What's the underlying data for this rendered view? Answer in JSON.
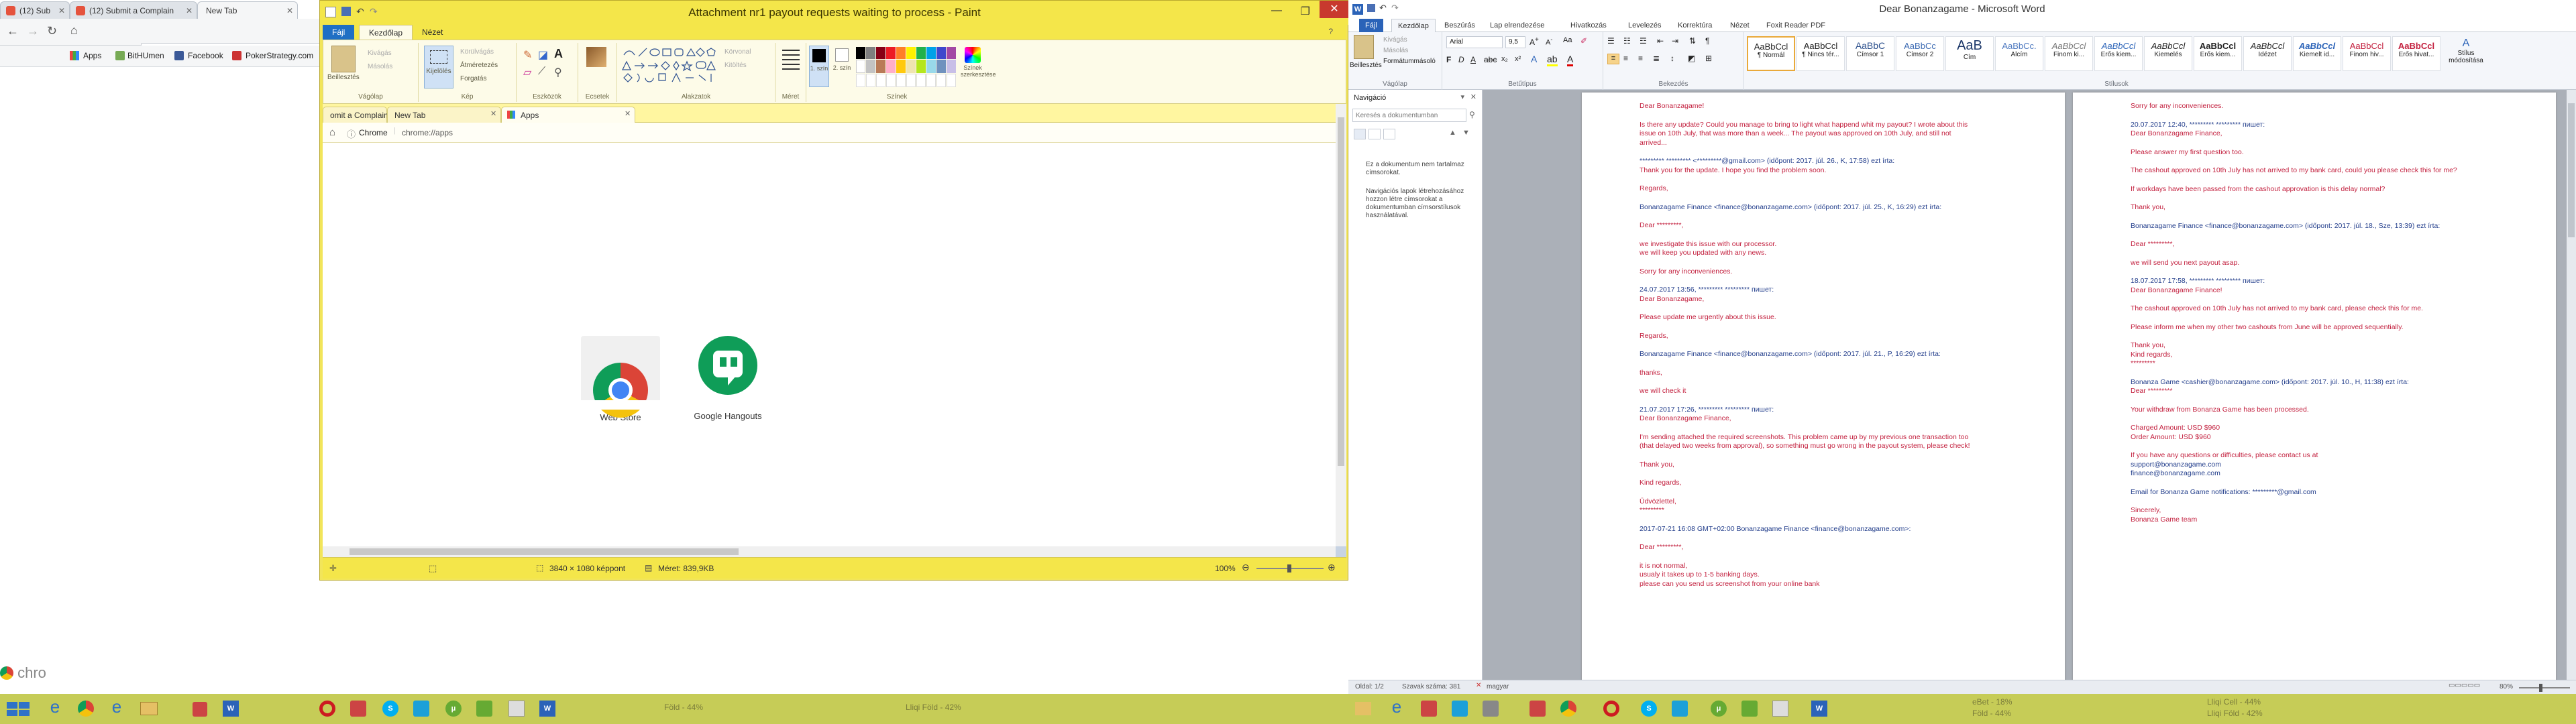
{
  "chrome": {
    "tabs": [
      "(12) Sub",
      "(12) Submit a Complain",
      "New Tab"
    ],
    "bookmarks": [
      "Apps",
      "BitHUmen",
      "Facebook",
      "PokerStrategy.com"
    ],
    "corner_text": "chro"
  },
  "paint": {
    "title": "Attachment nr1 payout requests waiting to process - Paint",
    "tabs": [
      "Fájl",
      "Kezdőlap",
      "Nézet"
    ],
    "groups": {
      "clipboard": {
        "paste": "Beillesztés",
        "cut": "Kivágás",
        "copy": "Másolás",
        "label": "Vágólap"
      },
      "image": {
        "select": "Kijelölés",
        "crop": "Körülvágás",
        "resize": "Átméretezés",
        "rotate": "Forgatás",
        "label": "Kép"
      },
      "tools": {
        "label": "Eszközök"
      },
      "brushes": {
        "label": "Ecsetek"
      },
      "shapes": {
        "outline": "Körvonal",
        "fill": "Kitöltés",
        "label": "Alakzatok"
      },
      "size": {
        "label": "Méret"
      },
      "colors": {
        "color1": "1. szín",
        "color2": "2. szín",
        "edit": "Színek szerkesztése",
        "label": "Színek"
      }
    },
    "status": {
      "dimensions": "3840 × 1080 képpont",
      "filesize": "Méret: 839,9KB",
      "zoom": "100%"
    },
    "screenshot": {
      "tabs": [
        "omit a Complain",
        "New Tab",
        "Apps"
      ],
      "address_site": "Chrome",
      "address_url": "chrome://apps",
      "apps": [
        "Web Store",
        "Google Hangouts"
      ]
    }
  },
  "word": {
    "title": "Dear Bonanzagame - Microsoft Word",
    "tabs": [
      "Fájl",
      "Kezdőlap",
      "Beszúrás",
      "Lap elrendezése",
      "Hivatkozás",
      "Levelezés",
      "Korrektúra",
      "Nézet",
      "Foxit Reader PDF"
    ],
    "ribbon": {
      "paste": "Beillesztés",
      "cut": "Kivágás",
      "copy": "Másolás",
      "format_painter": "Formátummásoló",
      "clipboard_label": "Vágólap",
      "font_label": "Betűtípus",
      "paragraph_label": "Bekezdés",
      "styles_label": "Stílusok",
      "font_name": "Arial",
      "font_size": "9,5",
      "styles": [
        "¶ Normál",
        "¶ Nincs tér...",
        "Címsor 1",
        "Címsor 2",
        "Cím",
        "Alcím",
        "Finom ki...",
        "Erős kiem...",
        "Kiemelés",
        "Erős kiem...",
        "Idézet",
        "Kiemelt id...",
        "Finom hiv...",
        "Erős hivat..."
      ],
      "change_styles": "Stílus módosítása"
    },
    "nav": {
      "title": "Navigáció",
      "search_placeholder": "Keresés a dokumentumban",
      "text1": "Ez a dokumentum nem tartalmaz címsorokat.",
      "text2": "Navigációs lapok létrehozásához hozzon létre címsorokat a dokumentumban címsorstílusok használatával."
    },
    "page1": [
      "Dear Bonanzagame!",
      "Is there any update? Could you manage to bring to light what happend whit my payout? I wrote about this",
      "issue on 10th July, that was more than a week... The payout was approved on 10th July, and still not",
      "arrived...",
      "********* ********* <*********@gmail.com> (időpont: 2017. júl. 26., K, 17:58) ezt írta:",
      "Thank you for the update. I hope you find the problem soon.",
      "Regards,",
      "Bonanzagame Finance <finance@bonanzagame.com> (időpont: 2017. júl. 25., K, 16:29) ezt írta:",
      "Dear *********,",
      "we investigate this issue with our processor.",
      "we will keep you updated with any news.",
      "Sorry for any inconveniences.",
      "24.07.2017 13:56, ********* ********* пишет:",
      "Dear Bonanzagame,",
      "Please update me urgently about this issue.",
      "Regards,",
      "Bonanzagame Finance <finance@bonanzagame.com> (időpont: 2017. júl. 21., P, 16:29) ezt írta:",
      "thanks,",
      "we will check it",
      "21.07.2017 17:26, ********* ********* пишет:",
      "Dear Bonanzagame Finance,",
      "I'm sending attached the required screenshots. This problem came up by my previous one transaction too",
      "(that delayed two weeks from approval), so something must go wrong in the payout system, please check!",
      "Thank you,",
      "Kind regards,",
      "Üdvözlettel,",
      "*********",
      "2017-07-21 16:08 GMT+02:00 Bonanzagame Finance <finance@bonanzagame.com>:",
      "Dear *********,",
      "it is not normal,",
      "usualy it takes up to 1-5 banking days.",
      "please can you send us screenshot from your online bank"
    ],
    "page2": [
      "Sorry for any inconveniences.",
      "20.07.2017 12:40, ********* ********* пишет:",
      "Dear Bonanzagame Finance,",
      "Please answer my first question too.",
      "The cashout approved on 10th July has not arrived to my bank card, could you please check this for me?",
      "If workdays have been passed from the cashout approvation is this delay normal?",
      "Thank you,",
      "Bonanzagame Finance <finance@bonanzagame.com> (időpont: 2017. júl. 18., Sze, 13:39) ezt írta:",
      "Dear *********,",
      "we will send you next payout asap.",
      "18.07.2017 17:58, ********* ********* пишет:",
      "Dear Bonanzagame Finance!",
      "The cashout approved on 10th July has not arrived to my bank card, please check this for me.",
      "Please inform me when my other two cashouts from June will be approved sequentially.",
      "Thank you,",
      "Kind regards,",
      "*********",
      "Bonanza Game <cashier@bonanzagame.com> (időpont: 2017. júl. 10., H, 11:38) ezt írta:",
      "Dear *********",
      "Your withdraw from Bonanza Game has been processed.",
      "Charged Amount: USD $960",
      "Order Amount: USD $960",
      "If you have any questions or difficulties, please contact us at",
      "support@bonanzagame.com",
      "finance@bonanzagame.com",
      "Email for Bonanza Game notifications: *********@gmail.com",
      "Sincerely,",
      "Bonanza Game team"
    ],
    "status": {
      "page": "Oldal: 1/2",
      "words": "Szavak száma: 381",
      "lang": "magyar",
      "zoom": "80%"
    }
  },
  "taskbar": {
    "labels": [
      "Föld - 44%",
      "Lliqi Föld - 42%",
      "eBet - 18%",
      "Föld - 44%",
      "Lliqi Cell - 44%",
      "Lliqi Föld - 42%"
    ]
  },
  "colors": {
    "paint_frame": "#f2e55a",
    "taskbar": "#c6cc57",
    "word_accent": "#2b63b8",
    "doc_red": "#c3213f"
  }
}
